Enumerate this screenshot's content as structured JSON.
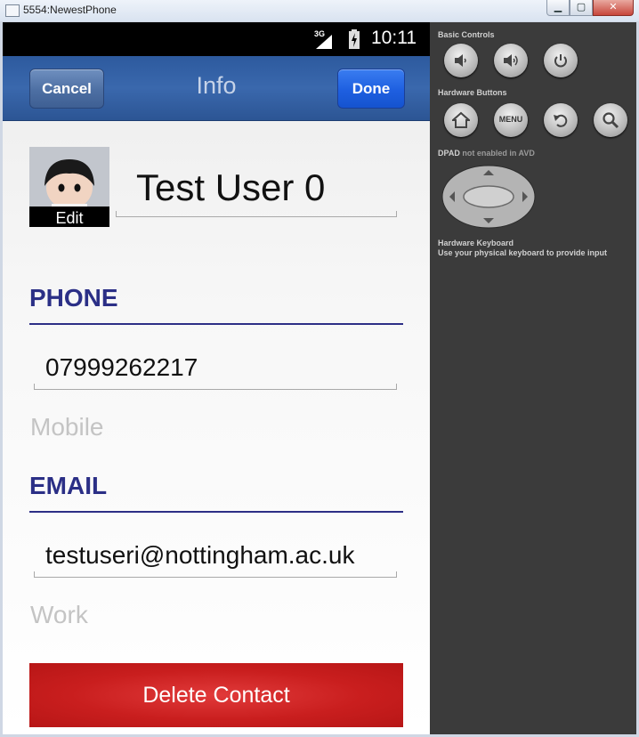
{
  "window": {
    "title": "5554:NewestPhone"
  },
  "status_bar": {
    "network": "3G",
    "time": "10:11"
  },
  "nav": {
    "cancel_label": "Cancel",
    "title": "Info",
    "done_label": "Done"
  },
  "contact": {
    "avatar_edit_label": "Edit",
    "name": "Test User 0",
    "phone_header": "PHONE",
    "phone_value": "07999262217",
    "phone_type": "Mobile",
    "email_header": "EMAIL",
    "email_value": "testuseri@nottingham.ac.uk",
    "email_type": "Work",
    "delete_label": "Delete Contact"
  },
  "controls": {
    "basic_label": "Basic Controls",
    "hardware_label": "Hardware Buttons",
    "menu_label": "MENU",
    "dpad_label": "DPAD",
    "dpad_note": "not enabled in AVD",
    "keyboard_label": "Hardware Keyboard",
    "keyboard_note": "Use your physical keyboard to provide input",
    "buttons": [
      "volume-down-icon",
      "volume-up-icon",
      "power-icon",
      "home-icon",
      "menu-icon",
      "back-icon",
      "search-icon"
    ]
  },
  "colors": {
    "nav_bar": "#2d5a9e",
    "done_button": "#1e5fe0",
    "section_header": "#2b2f86",
    "delete_button": "#c91e1e",
    "panel_bg": "#3b3b3b"
  }
}
